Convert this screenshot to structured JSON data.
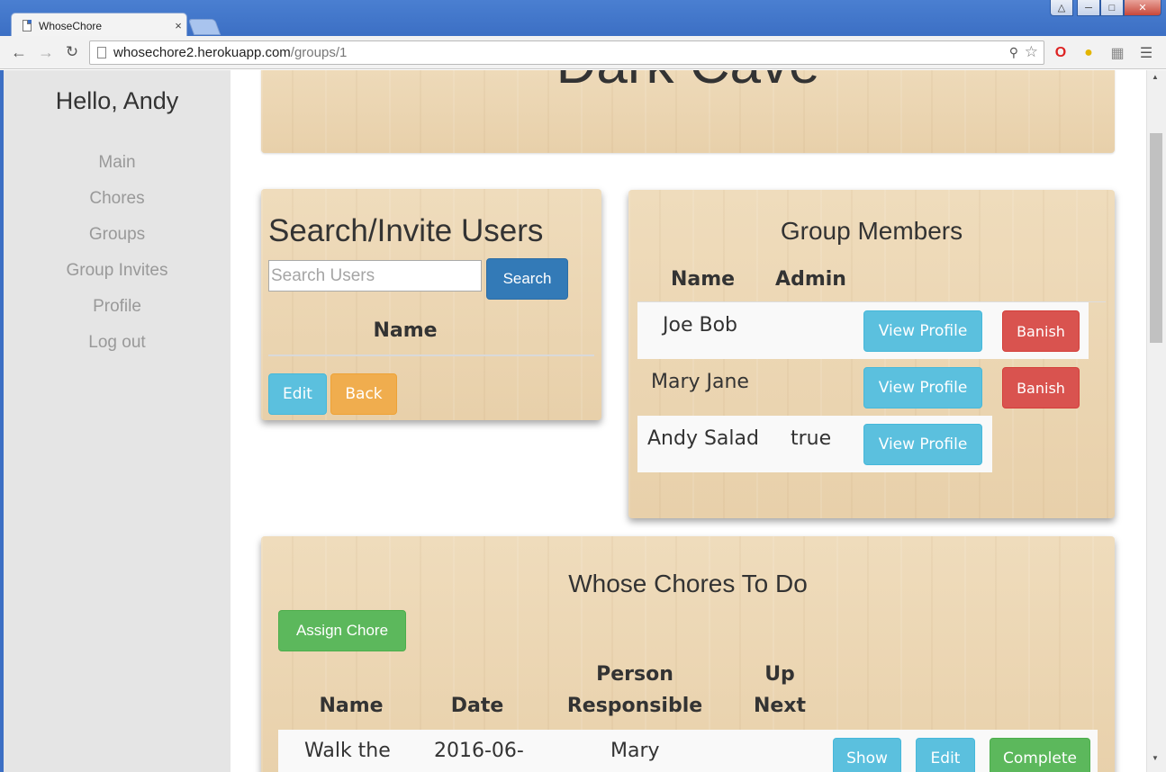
{
  "browser": {
    "tab_title": "WhoseChore",
    "tab_close": "×",
    "url_host": "whosechore2.herokuapp.com",
    "url_path": "/groups/1",
    "icons": [
      "page-icon",
      "back-arrow-icon",
      "forward-arrow-icon",
      "reload-icon",
      "key-icon",
      "star-icon",
      "opera-icon",
      "lemon-icon",
      "puzzle-icon",
      "menu-icon"
    ]
  },
  "sidebar": {
    "greeting": "Hello, Andy",
    "links": [
      "Main",
      "Chores",
      "Groups",
      "Group Invites",
      "Profile",
      "Log out"
    ]
  },
  "hero": {
    "title": "Dark Cave"
  },
  "search_panel": {
    "title": "Search/Invite Users",
    "search_placeholder": "Search Users",
    "search_button": "Search",
    "col_name": "Name",
    "edit_button": "Edit",
    "back_button": "Back"
  },
  "members_panel": {
    "title": "Group Members",
    "col_name": "Name",
    "col_admin": "Admin",
    "members": [
      {
        "name": "Joe Bob",
        "admin": "",
        "view_label": "View Profile",
        "banish_label": "Banish"
      },
      {
        "name": "Mary Jane",
        "admin": "",
        "view_label": "View Profile",
        "banish_label": "Banish"
      },
      {
        "name": "Andy Salad",
        "admin": "true",
        "view_label": "View Profile",
        "banish_label": ""
      }
    ]
  },
  "chores_panel": {
    "title": "Whose Chores To Do",
    "assign_button": "Assign Chore",
    "col_name": "Name",
    "col_date": "Date",
    "col_person_line1": "Person",
    "col_person_line2": "Responsible",
    "col_up_line1": "Up",
    "col_up_line2": "Next",
    "rows": [
      {
        "name": "Walk the",
        "date": "2016-06-",
        "person": "Mary",
        "up_next": "",
        "show_label": "Show",
        "edit_label": "Edit",
        "complete_label": "Complete"
      }
    ]
  },
  "colors": {
    "primary": "#337ab7",
    "info": "#5bc0de",
    "warning": "#f0ad4e",
    "danger": "#d9534f",
    "success": "#5cb85c",
    "sidebar_bg": "#e5e5e5",
    "wood": "#ecd6b4"
  }
}
